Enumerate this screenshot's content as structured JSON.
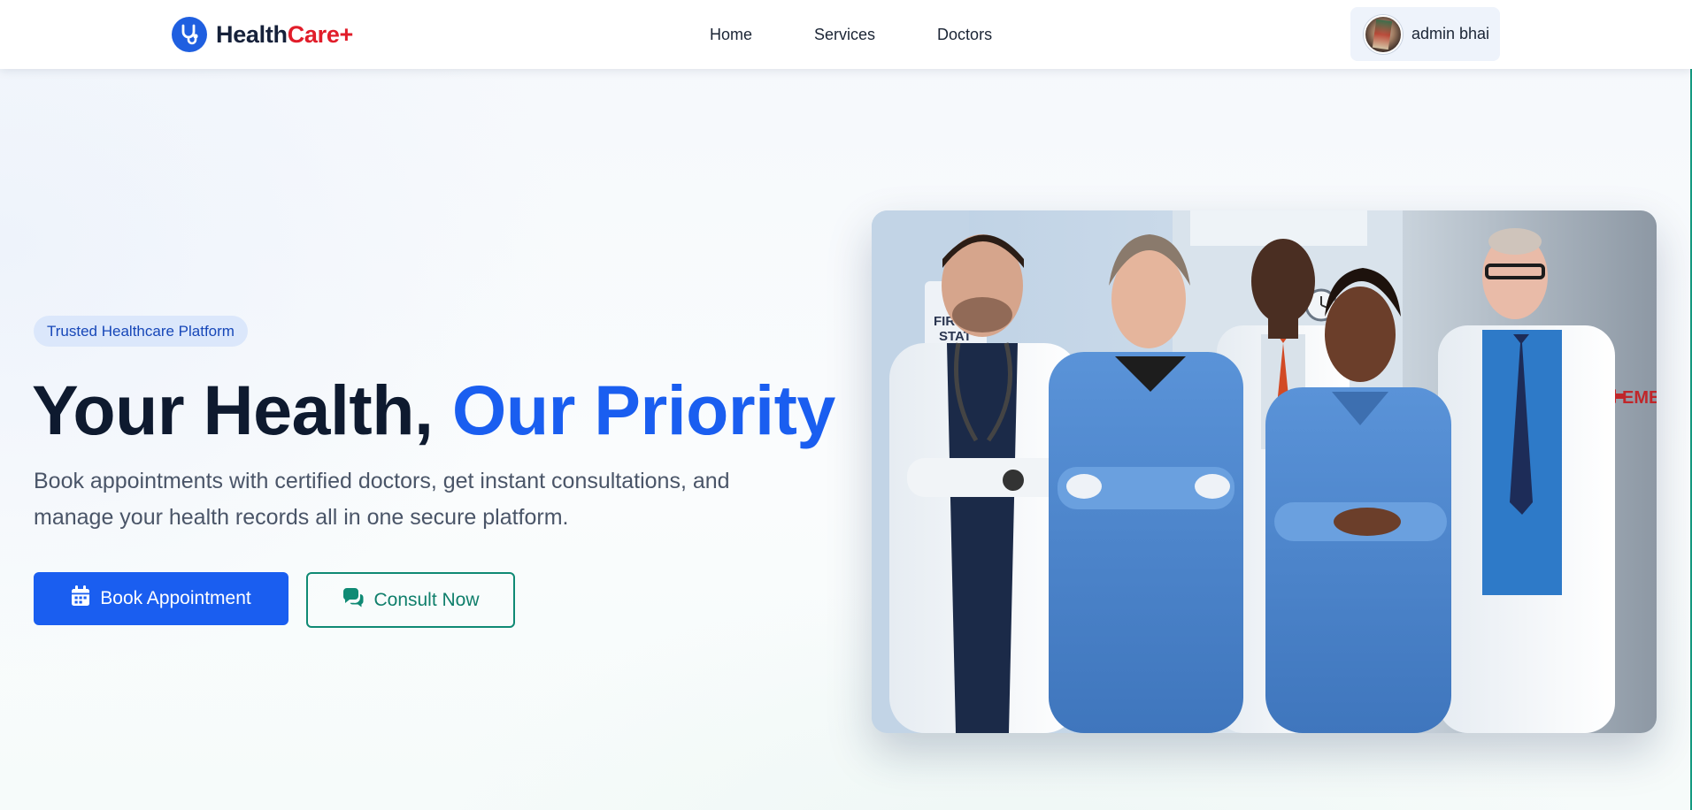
{
  "navbar": {
    "brand": {
      "name_part1": "Health",
      "name_part2": "Care+",
      "icon": "stethoscope-icon"
    },
    "links": [
      {
        "label": "Home"
      },
      {
        "label": "Services"
      },
      {
        "label": "Doctors"
      }
    ],
    "user": {
      "name": "admin bhai",
      "avatar": "user-avatar"
    }
  },
  "hero": {
    "badge": "Trusted Healthcare Platform",
    "headline_part1": "Your Health, ",
    "headline_part2": "Our Priority",
    "subtext": "Book appointments with certified doctors, get instant consultations, and manage your health records all in one secure platform.",
    "primary_button": {
      "label": "Book Appointment",
      "icon": "calendar-icon"
    },
    "secondary_button": {
      "label": "Consult Now",
      "icon": "chat-bubbles-icon"
    },
    "image_signs": {
      "sign_left_line1": "FIRST",
      "sign_left_line2": "STAT",
      "sign_right": "EMERGE"
    }
  },
  "colors": {
    "primary": "#1a5ef0",
    "brand_accent": "#e11d2a",
    "secondary": "#0f8a74",
    "text_dark": "#0e1a2f",
    "text_muted": "#4a5568",
    "badge_bg": "#dbe7fb"
  }
}
